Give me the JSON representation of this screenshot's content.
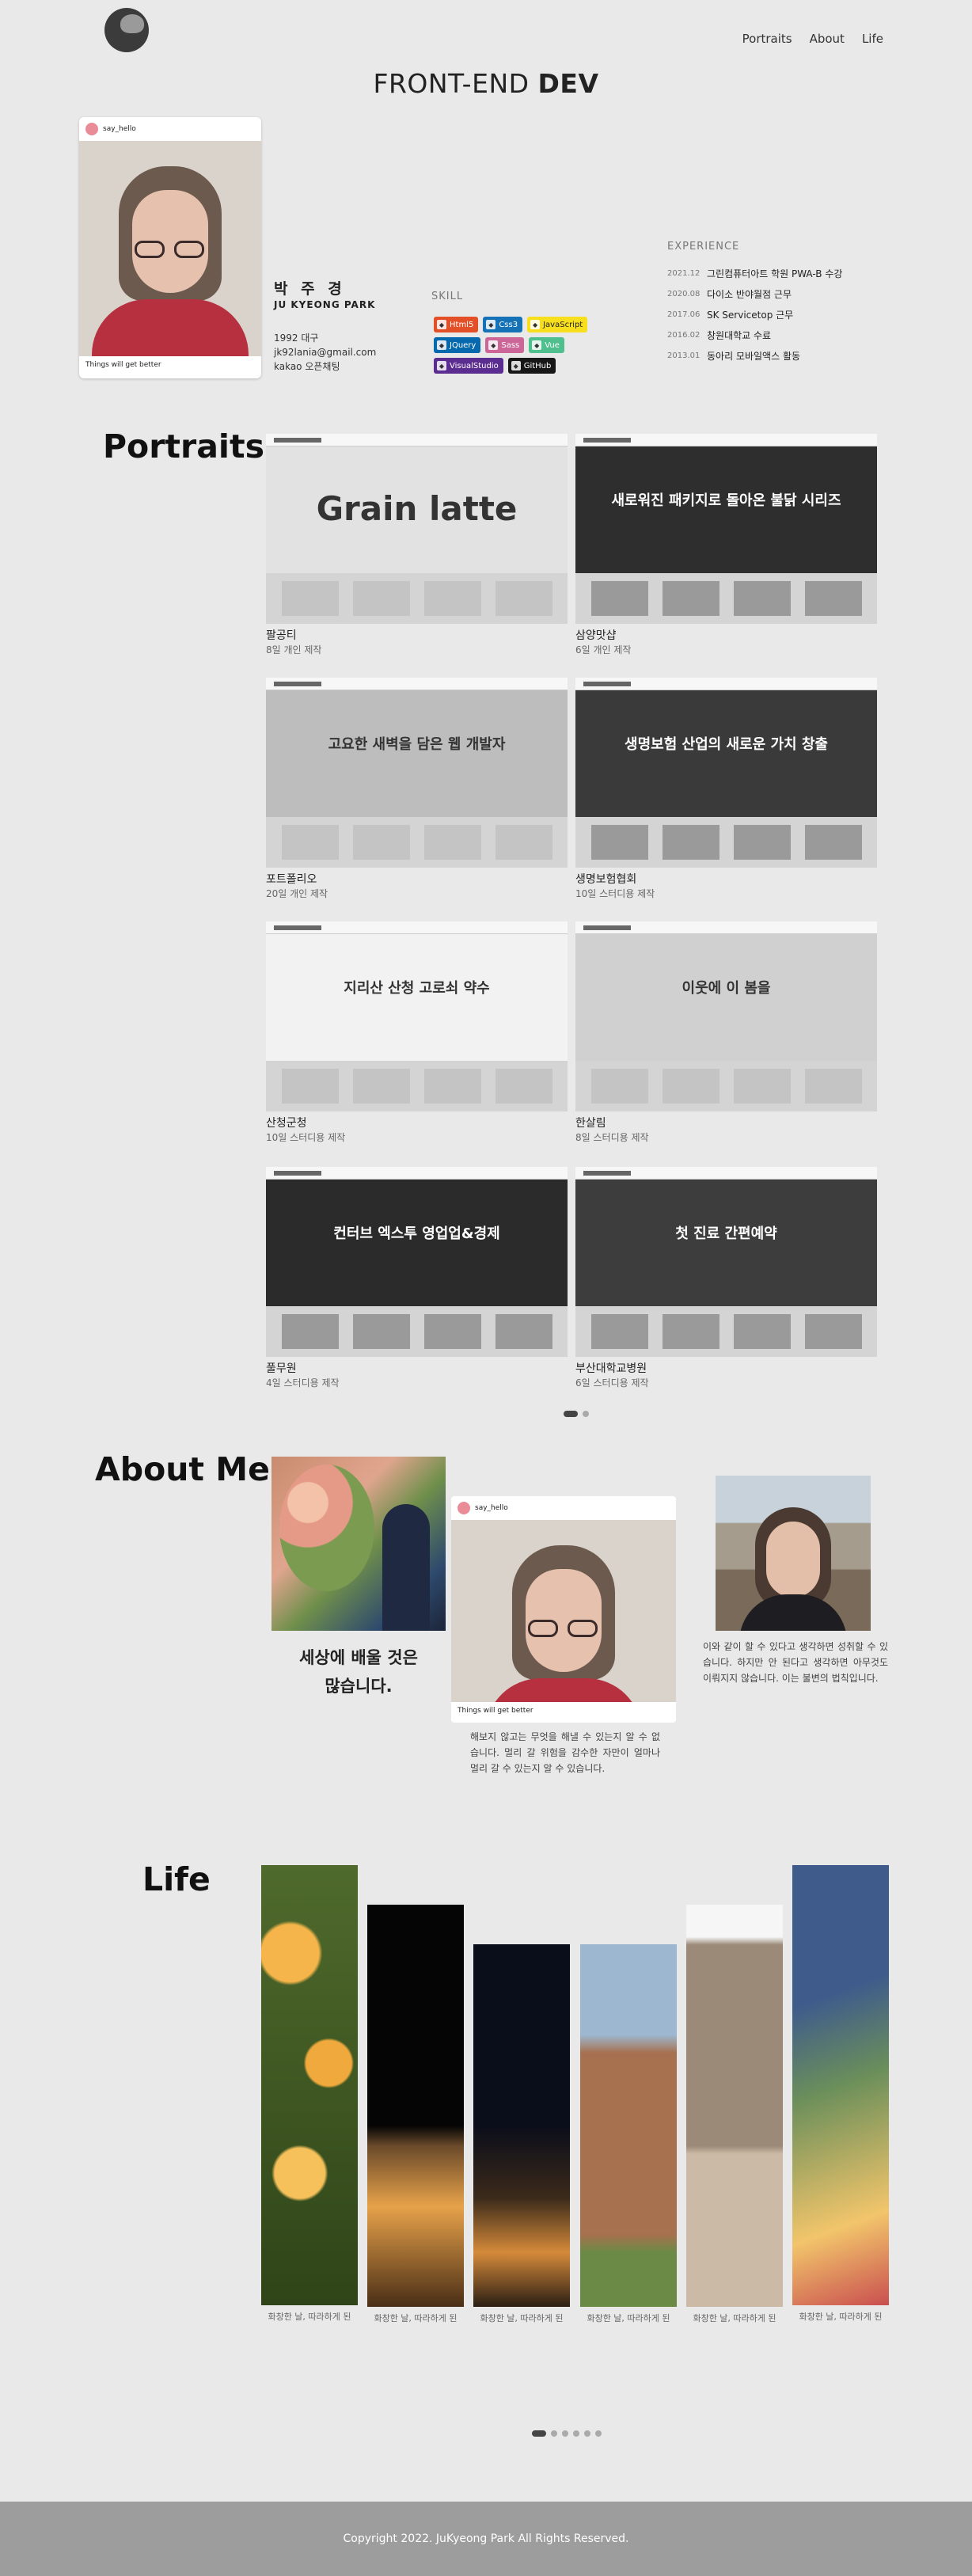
{
  "header": {
    "nav": [
      "Portraits",
      "About",
      "Life"
    ],
    "title_light": "FRONT-END ",
    "title_bold": "DEV"
  },
  "profile_card": {
    "handle": "say_hello",
    "caption": "Things will get better"
  },
  "profile": {
    "name_ko": "박 주 경",
    "name_en": "JU KYEONG PARK",
    "birth": "1992 대구",
    "email": "jk92lania@gmail.com",
    "kakao": "kakao 오픈채팅"
  },
  "skill": {
    "title": "SKILL",
    "badges": [
      {
        "label": "Html5",
        "color": "#e34f26",
        "icon": "html5-icon"
      },
      {
        "label": "Css3",
        "color": "#1572b6",
        "icon": "css3-icon"
      },
      {
        "label": "JavaScript",
        "color": "#f7df1e",
        "icon": "javascript-icon"
      },
      {
        "label": "JQuery",
        "color": "#0769ad",
        "icon": "jquery-icon"
      },
      {
        "label": "Sass",
        "color": "#cc6699",
        "icon": "sass-icon"
      },
      {
        "label": "Vue",
        "color": "#4fc08d",
        "icon": "vue-icon"
      },
      {
        "label": "VisualStudio",
        "color": "#5c2d91",
        "icon": "visualstudio-icon"
      },
      {
        "label": "GitHub",
        "color": "#181717",
        "icon": "github-icon"
      }
    ]
  },
  "experience": {
    "title": "EXPERIENCE",
    "items": [
      {
        "year": "2021.12",
        "text": "그린컴퓨터아트 학원 PWA-B 수강"
      },
      {
        "year": "2020.08",
        "text": "다이소 반야월점 근무"
      },
      {
        "year": "2017.06",
        "text": "SK Servicetop 근무"
      },
      {
        "year": "2016.02",
        "text": "창원대학교 수료"
      },
      {
        "year": "2013.01",
        "text": "동아리 모바일액스 활동"
      }
    ]
  },
  "portraits": {
    "title": "Portraits",
    "items": [
      {
        "name": "팔공티",
        "sub": "8일 개인 제작",
        "headline": "Grain latte"
      },
      {
        "name": "삼양맛샵",
        "sub": "6일 개인 제작",
        "headline": "새로워진 패키지로 돌아온 불닭 시리즈"
      },
      {
        "name": "포트폴리오",
        "sub": "20일 개인 제작",
        "headline": "고요한 새벽을 담은 웹 개발자"
      },
      {
        "name": "생명보험협회",
        "sub": "10일 스터디용 제작",
        "headline": "생명보험 산업의 새로운 가치 창출"
      },
      {
        "name": "산청군청",
        "sub": "10일 스터디용 제작",
        "headline": "지리산 산청 고로쇠 약수"
      },
      {
        "name": "한살림",
        "sub": "8일 스터디용 제작",
        "headline": "이웃에 이 봄을"
      },
      {
        "name": "풀무원",
        "sub": "4일 스터디용 제작",
        "headline": "컨터브 엑스투 영업업&경제"
      },
      {
        "name": "부산대학교병원",
        "sub": "6일 스터디용 제작",
        "headline": "첫 진료 간편예약"
      }
    ]
  },
  "about": {
    "title": "About  Me",
    "quote_line1": "세상에 배울 것은",
    "quote_line2": "많습니다.",
    "text_middle": "해보지 않고는 무엇을 해낼 수 있는지 알 수 없습니다. 멀리 갈 위험을 감수한 자만이 얼마나 멀리 갈 수 있는지 알 수 있습니다.",
    "text_right": "이와 같이 할 수 있다고 생각하면 성취할 수 있습니다. 하지만 안 된다고 생각하면 아무것도 이뤄지지 않습니다. 이는 불변의 법칙입니다."
  },
  "life": {
    "title": "Life",
    "caption": "화창한 날, 따라하게 된"
  },
  "footer": {
    "copyright": "Copyright 2022. JuKyeong Park All Rights Reserved."
  }
}
